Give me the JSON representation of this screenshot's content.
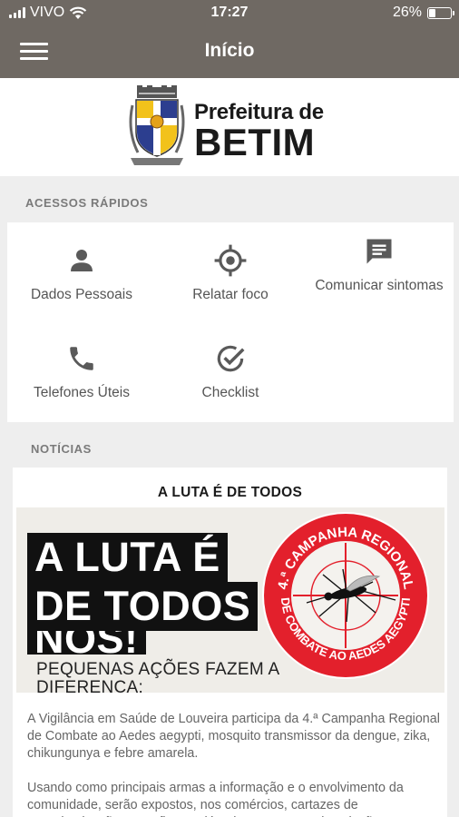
{
  "status_bar": {
    "carrier": "VIVO",
    "time": "17:27",
    "battery": "26%",
    "battery_level": 0.26
  },
  "app_bar": {
    "title": "Início",
    "menu_icon": "hamburger-icon"
  },
  "logo": {
    "line1": "Prefeitura de",
    "line2": "BETIM"
  },
  "quick_access": {
    "section_title": "ACESSOS RÁPIDOS",
    "items": [
      {
        "label": "Dados Pessoais",
        "icon": "person-icon"
      },
      {
        "label": "Relatar foco",
        "icon": "target-icon"
      },
      {
        "label": "Comunicar sintomas",
        "icon": "chat-icon"
      },
      {
        "label": "Telefones Úteis",
        "icon": "phone-icon"
      },
      {
        "label": "Checklist",
        "icon": "check-circle-icon"
      }
    ]
  },
  "news": {
    "section_title": "NOTÍCIAS",
    "article": {
      "title": "A LUTA É DE TODOS",
      "banner": {
        "line1": "A LUTA É",
        "line2": "DE TODOS",
        "line3": "NÓS!",
        "subtitle_line1": "PEQUENAS AÇÕES FAZEM A",
        "subtitle_line2": "DIFERENÇA:",
        "seal_top": "4.ª CAMPANHA REGIONAL",
        "seal_bottom": "DE COMBATE AO AEDES AEGYPTI",
        "seal_color": "#e3202c"
      },
      "paragraphs": [
        "A Vigilância em Saúde de Louveira participa da 4.ª Campanha Regional de Combate ao Aedes aegypti, mosquito transmissor da dengue, zika, chikungunya e febre amarela.",
        "Usando como principais armas a informação e o envolvimento da comunidade, serão expostos, nos comércios, cartazes de conscientização, e panfletos, além de cartazes e a instalação"
      ]
    }
  },
  "colors": {
    "header": "#6f6963",
    "background": "#eeeeee",
    "icon": "#5a5a5a"
  }
}
